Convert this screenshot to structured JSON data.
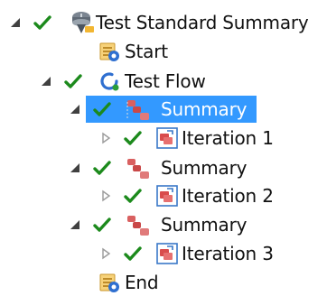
{
  "tree": {
    "items": [
      {
        "label": "Test Standard Summary",
        "icon": "test-standard-icon",
        "expanded": true,
        "checked": true
      },
      {
        "label": "Start",
        "icon": "start-icon"
      },
      {
        "label": "Test Flow",
        "icon": "test-flow-icon",
        "expanded": true,
        "checked": true
      },
      {
        "label": "Summary",
        "icon": "summary-icon",
        "expanded": true,
        "checked": true,
        "selected": true
      },
      {
        "label": "Iteration 1",
        "icon": "iteration-icon",
        "expanded": false,
        "checked": true
      },
      {
        "label": "Summary",
        "icon": "summary-icon",
        "expanded": true,
        "checked": true
      },
      {
        "label": "Iteration 2",
        "icon": "iteration-icon",
        "expanded": false,
        "checked": true
      },
      {
        "label": "Summary",
        "icon": "summary-icon",
        "expanded": true,
        "checked": true
      },
      {
        "label": "Iteration 3",
        "icon": "iteration-icon",
        "expanded": false,
        "checked": true
      },
      {
        "label": "End",
        "icon": "end-icon"
      }
    ]
  },
  "colors": {
    "selection": "#3399ff",
    "check": "#1c8a1c",
    "expander": "#404040",
    "collapsed_expander": "#9a9a9a"
  }
}
